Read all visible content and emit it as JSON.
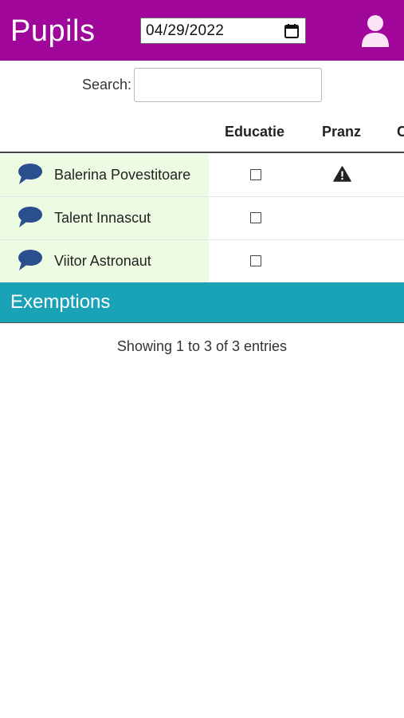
{
  "header": {
    "title": "Pupils",
    "date_value": "04/29/2022",
    "calendar_icon": "calendar-icon",
    "user_icon": "user-icon",
    "background_color": "#a0069a"
  },
  "search": {
    "label": "Search:",
    "value": ""
  },
  "table": {
    "columns": [
      "",
      "Educatie",
      "Pranz",
      "C"
    ],
    "rows": [
      {
        "name": "Balerina Povestitoare",
        "educatie_checked": false,
        "pranz_warning": true
      },
      {
        "name": "Talent Innascut",
        "educatie_checked": false,
        "pranz_warning": false
      },
      {
        "name": "Viitor Astronaut",
        "educatie_checked": false,
        "pranz_warning": false
      }
    ]
  },
  "exemptions": {
    "title": "Exemptions",
    "color": "#1aa2b6"
  },
  "info": {
    "text": "Showing 1 to 3 of 3 entries"
  }
}
